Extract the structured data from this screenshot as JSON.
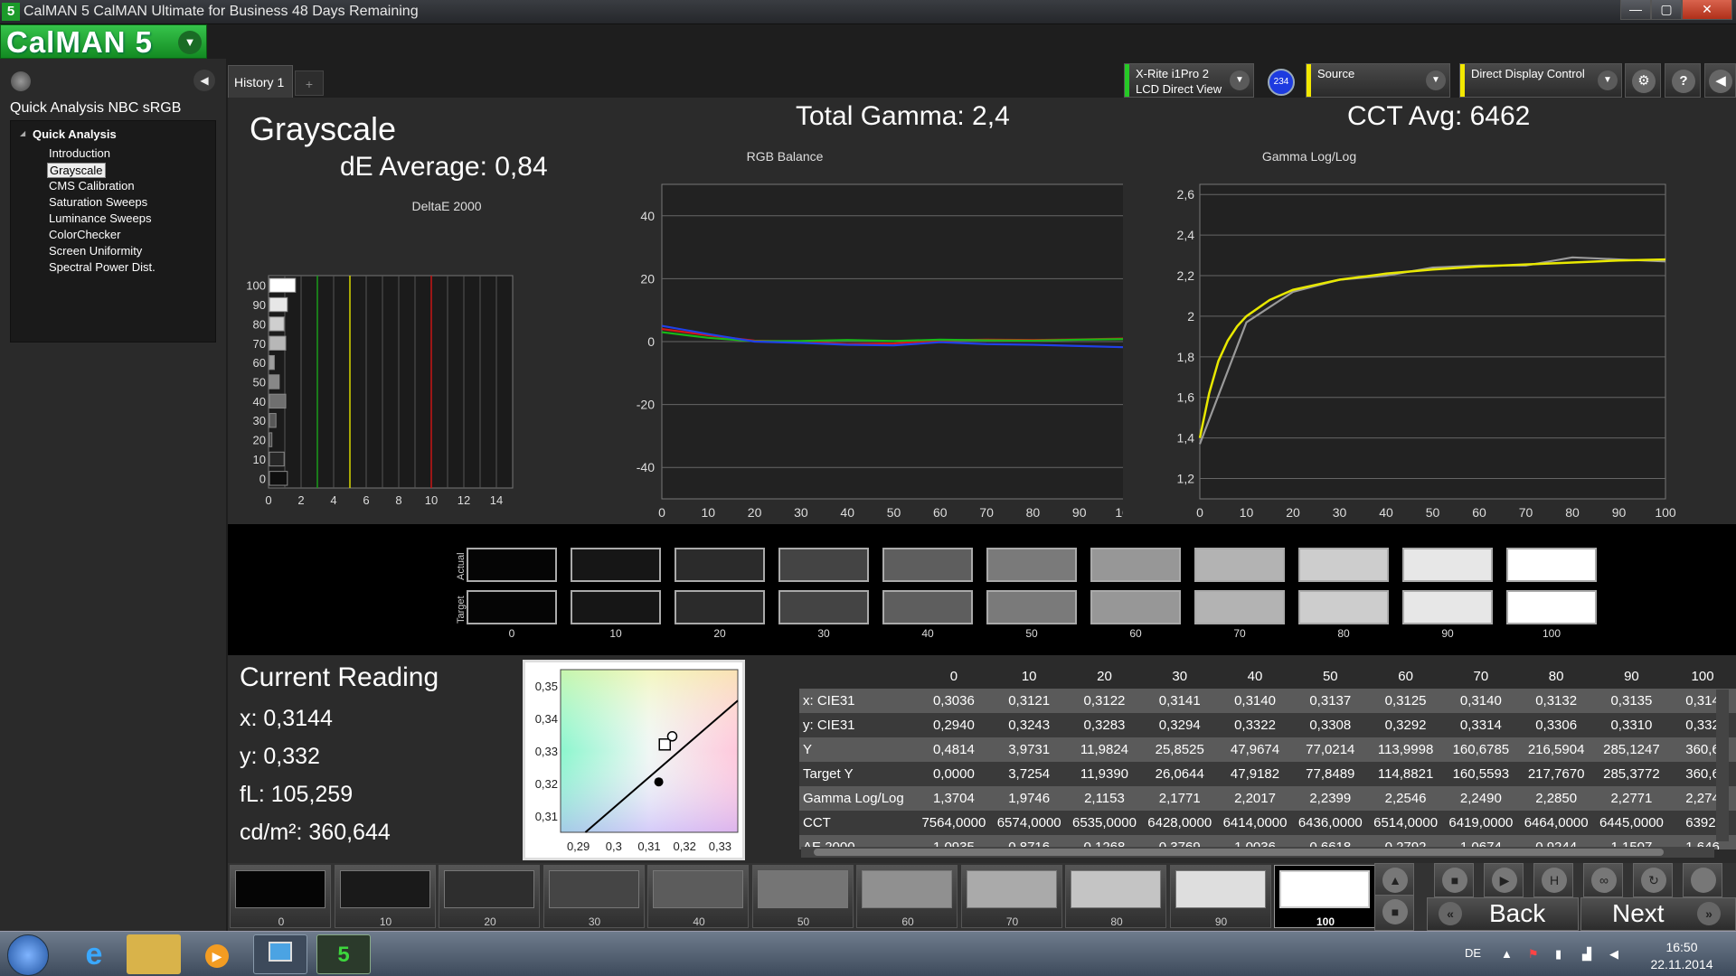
{
  "window": {
    "title": "CalMAN 5 CalMAN Ultimate for Business 48 Days Remaining",
    "app_icon": "5",
    "min_icon": "minimize-icon",
    "max_icon": "maximize-icon",
    "close_icon": "close-icon"
  },
  "logo": {
    "text": "CalMAN 5"
  },
  "sidebar": {
    "workflow_title": "Quick Analysis NBC sRGB",
    "root": "Quick Analysis",
    "items": [
      "Introduction",
      "Grayscale",
      "CMS Calibration",
      "Saturation Sweeps",
      "Luminance Sweeps",
      "ColorChecker",
      "Screen Uniformity",
      "Spectral Power Dist."
    ],
    "selected": "Grayscale"
  },
  "tabs": {
    "history": "History 1",
    "add": "+"
  },
  "devices": {
    "meter_line1": "X-Rite i1Pro 2",
    "meter_line2": "LCD Direct View",
    "badge": "234",
    "source": "Source",
    "display": "Direct Display Control",
    "colors": {
      "meter": "#26c926",
      "source": "#f2e800",
      "display": "#f2e800"
    }
  },
  "main": {
    "title": "Grayscale",
    "de_average": "dE Average: 0,84",
    "total_gamma": "Total Gamma: 2,4",
    "cct_avg": "CCT Avg: 6462"
  },
  "deltae_chart": {
    "title": "DeltaE 2000",
    "x_ticks": [
      "0",
      "2",
      "4",
      "6",
      "8",
      "10",
      "12",
      "14"
    ],
    "categories": [
      "100",
      "90",
      "80",
      "70",
      "60",
      "50",
      "40",
      "30",
      "20",
      "10",
      "0"
    ],
    "values": [
      1.6,
      1.1,
      0.9,
      1.0,
      0.3,
      0.6,
      1.0,
      0.4,
      0.0,
      0.9,
      1.1
    ],
    "xlim": [
      0,
      15
    ],
    "threshold_lines": [
      {
        "x": 3,
        "color": "#1a9a1a"
      },
      {
        "x": 5,
        "color": "#d8d800"
      },
      {
        "x": 10,
        "color": "#c81414"
      }
    ]
  },
  "rgb_chart": {
    "title": "RGB Balance",
    "y_ticks": [
      "40",
      "20",
      "0",
      "-20",
      "-40"
    ],
    "x_ticks": [
      "0",
      "10",
      "20",
      "30",
      "40",
      "50",
      "60",
      "70",
      "80",
      "90",
      "100"
    ],
    "ylim": [
      -50,
      50
    ],
    "x": [
      0,
      10,
      20,
      30,
      40,
      50,
      60,
      70,
      80,
      90,
      100
    ],
    "series": [
      {
        "color": "#d81818",
        "values": [
          4.0,
          2.0,
          0.3,
          0.0,
          -0.8,
          -0.6,
          0.4,
          0.6,
          0.5,
          0.7,
          1.0
        ]
      },
      {
        "color": "#18b818",
        "values": [
          3.0,
          1.2,
          0.1,
          0.2,
          0.5,
          0.2,
          0.6,
          0.4,
          0.3,
          0.6,
          0.8
        ]
      },
      {
        "color": "#2040e8",
        "values": [
          5.0,
          2.4,
          0.0,
          -0.4,
          -1.0,
          -1.2,
          -0.2,
          -0.8,
          -1.0,
          -1.4,
          -1.8
        ]
      }
    ]
  },
  "gamma_chart": {
    "title": "Gamma Log/Log",
    "y_ticks": [
      "2,6",
      "2,4",
      "2,2",
      "2",
      "1,8",
      "1,6",
      "1,4",
      "1,2"
    ],
    "x_ticks": [
      "0",
      "10",
      "20",
      "30",
      "40",
      "50",
      "60",
      "70",
      "80",
      "90",
      "100"
    ],
    "ylim": [
      1.1,
      2.65
    ],
    "target": {
      "color": "#e8e800",
      "x": [
        0,
        2,
        4,
        6,
        8,
        10,
        15,
        20,
        30,
        40,
        50,
        60,
        70,
        80,
        90,
        100
      ],
      "values": [
        1.4,
        1.62,
        1.78,
        1.88,
        1.95,
        2.0,
        2.08,
        2.13,
        2.18,
        2.21,
        2.23,
        2.245,
        2.255,
        2.265,
        2.275,
        2.28
      ]
    },
    "measured": {
      "color": "#9a9a9a",
      "x": [
        0,
        10,
        20,
        30,
        40,
        50,
        60,
        70,
        80,
        90,
        100
      ],
      "values": [
        1.37,
        1.97,
        2.12,
        2.18,
        2.2,
        2.24,
        2.25,
        2.25,
        2.29,
        2.28,
        2.27
      ]
    }
  },
  "swatches": {
    "actual_label": "Actual",
    "target_label": "Target",
    "labels": [
      "0",
      "10",
      "20",
      "30",
      "40",
      "50",
      "60",
      "70",
      "80",
      "90",
      "100"
    ],
    "actual_colors": [
      "#050505",
      "#161616",
      "#2b2b2b",
      "#444444",
      "#5e5e5e",
      "#7a7a7a",
      "#979797",
      "#b3b3b3",
      "#cdcdcd",
      "#e7e7e7",
      "#ffffff"
    ],
    "target_colors": [
      "#050505",
      "#161616",
      "#2b2b2b",
      "#444444",
      "#5e5e5e",
      "#7a7a7a",
      "#979797",
      "#b3b3b3",
      "#cdcdcd",
      "#e7e7e7",
      "#ffffff"
    ]
  },
  "current_reading": {
    "title": "Current Reading",
    "x": "x: 0,3144",
    "y": "y: 0,332",
    "fl": "fL: 105,259",
    "cdm2": "cd/m²: 360,644"
  },
  "cie": {
    "x_ticks": [
      "0,29",
      "0,3",
      "0,31",
      "0,32",
      "0,33"
    ],
    "y_ticks": [
      "0,35",
      "0,34",
      "0,33",
      "0,32",
      "0,31"
    ],
    "xlim": [
      0.285,
      0.335
    ],
    "ylim": [
      0.305,
      0.355
    ]
  },
  "table": {
    "columns": [
      "0",
      "10",
      "20",
      "30",
      "40",
      "50",
      "60",
      "70",
      "80",
      "90",
      "100"
    ],
    "rows": [
      {
        "label": "x: CIE31",
        "values": [
          "0,3036",
          "0,3121",
          "0,3122",
          "0,3141",
          "0,3140",
          "0,3137",
          "0,3125",
          "0,3140",
          "0,3132",
          "0,3135",
          "0,314"
        ]
      },
      {
        "label": "y: CIE31",
        "values": [
          "0,2940",
          "0,3243",
          "0,3283",
          "0,3294",
          "0,3322",
          "0,3308",
          "0,3292",
          "0,3314",
          "0,3306",
          "0,3310",
          "0,332"
        ]
      },
      {
        "label": "Y",
        "values": [
          "0,4814",
          "3,9731",
          "11,9824",
          "25,8525",
          "47,9674",
          "77,0214",
          "113,9998",
          "160,6785",
          "216,5904",
          "285,1247",
          "360,6"
        ]
      },
      {
        "label": "Target Y",
        "values": [
          "0,0000",
          "3,7254",
          "11,9390",
          "26,0644",
          "47,9182",
          "77,8489",
          "114,8821",
          "160,5593",
          "217,7670",
          "285,3772",
          "360,6"
        ]
      },
      {
        "label": "Gamma Log/Log",
        "values": [
          "1,3704",
          "1,9746",
          "2,1153",
          "2,1771",
          "2,2017",
          "2,2399",
          "2,2546",
          "2,2490",
          "2,2850",
          "2,2771",
          "2,274"
        ]
      },
      {
        "label": "CCT",
        "values": [
          "7564,0000",
          "6574,0000",
          "6535,0000",
          "6428,0000",
          "6414,0000",
          "6436,0000",
          "6514,0000",
          "6419,0000",
          "6464,0000",
          "6445,0000",
          "6392,"
        ]
      },
      {
        "label": "ΔE 2000",
        "values": [
          "1,0935",
          "0,8716",
          "0,1268",
          "0,3769",
          "1,0036",
          "0,6618",
          "0,2792",
          "1,0674",
          "0,9244",
          "1,1507",
          "1,646"
        ]
      }
    ]
  },
  "patches": {
    "labels": [
      "0",
      "10",
      "20",
      "30",
      "40",
      "50",
      "60",
      "70",
      "80",
      "90",
      "100"
    ],
    "colors": [
      "#050505",
      "#1a1a1a",
      "#2e2e2e",
      "#454545",
      "#5c5c5c",
      "#757575",
      "#909090",
      "#aaaaaa",
      "#c4c4c4",
      "#dedede",
      "#ffffff"
    ],
    "active": "100"
  },
  "navigation": {
    "back": "Back",
    "next": "Next"
  },
  "taskbar": {
    "lang": "DE",
    "time": "16:50",
    "date": "22.11.2014"
  }
}
